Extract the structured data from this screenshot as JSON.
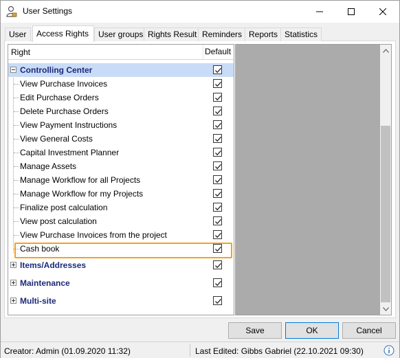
{
  "window": {
    "title": "User Settings"
  },
  "tabs": [
    {
      "label": "User"
    },
    {
      "label": "Access Rights"
    },
    {
      "label": "User groups"
    },
    {
      "label": "Rights Result"
    },
    {
      "label": "Reminders"
    },
    {
      "label": "Reports"
    },
    {
      "label": "Statistics"
    }
  ],
  "grid": {
    "columns": {
      "right": "Right",
      "default": "Default"
    },
    "rows": [
      {
        "label": "Controlling Center",
        "type": "group",
        "expanded": true,
        "checked": true
      },
      {
        "label": "View Purchase Invoices",
        "type": "child",
        "checked": true
      },
      {
        "label": "Edit Purchase Orders",
        "type": "child",
        "checked": true
      },
      {
        "label": "Delete Purchase Orders",
        "type": "child",
        "checked": true
      },
      {
        "label": "View Payment Instructions",
        "type": "child",
        "checked": true
      },
      {
        "label": "View General Costs",
        "type": "child",
        "checked": true
      },
      {
        "label": "Capital Investment Planner",
        "type": "child",
        "checked": true
      },
      {
        "label": "Manage Assets",
        "type": "child",
        "checked": true
      },
      {
        "label": "Manage Workflow for all Projects",
        "type": "child",
        "checked": true
      },
      {
        "label": "Manage Workflow for my Projects",
        "type": "child",
        "checked": true
      },
      {
        "label": "Finalize post calculation",
        "type": "child",
        "checked": true
      },
      {
        "label": "View post calculation",
        "type": "child",
        "checked": true
      },
      {
        "label": "View Purchase Invoices from the project",
        "type": "child",
        "checked": true
      },
      {
        "label": "Cash book",
        "type": "child",
        "checked": true
      },
      {
        "label": "Items/Addresses",
        "type": "group",
        "expanded": false,
        "checked": true
      },
      {
        "label": "Maintenance",
        "type": "group",
        "expanded": false,
        "checked": true
      },
      {
        "label": "Multi-site",
        "type": "group",
        "expanded": false,
        "checked": true
      }
    ]
  },
  "buttons": {
    "save": "Save",
    "ok": "OK",
    "cancel": "Cancel"
  },
  "status": {
    "creator": "Creator: Admin  (01.09.2020 11:32)",
    "last_edited": "Last Edited:  Gibbs Gabriel  (22.10.2021 09:30)"
  },
  "icons": {
    "title": "user-lock-icon",
    "info": "info-icon"
  },
  "colors": {
    "highlight": "#f5a11c",
    "selected_row": "#c9dcf7",
    "group_text": "#1a2a7a"
  }
}
